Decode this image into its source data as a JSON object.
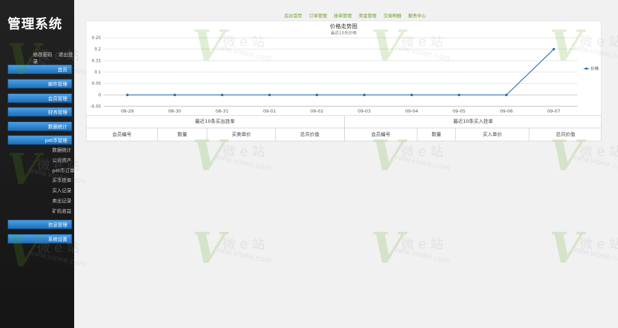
{
  "sidebar": {
    "title": "管理系统",
    "user_links": [
      "修改密码",
      "退出登录"
    ],
    "menu": [
      "首页",
      "邮件管理",
      "会员管理",
      "财务管理",
      "数据统计",
      "pet币管理"
    ],
    "submenu": [
      "数据统计",
      "公司资产",
      "pet币订单",
      "买币挂单",
      "买入记录",
      "卖出记录",
      "矿机收益"
    ],
    "menu_bottom": [
      "信息管理",
      "系统设置"
    ]
  },
  "topnav": [
    "后台首页",
    "订单管理",
    "挂单管理",
    "奖金管理",
    "交易明细",
    "服务中心"
  ],
  "chart_data": {
    "type": "line",
    "title": "价格走势图",
    "subtitle": "最近10天价格",
    "categories": [
      "08-29",
      "08-30",
      "08-31",
      "09-01",
      "09-02",
      "09-03",
      "09-04",
      "09-05",
      "09-06",
      "09-07"
    ],
    "series": [
      {
        "name": "价格",
        "values": [
          0,
          0,
          0,
          0,
          0,
          0,
          0,
          0,
          0,
          0.2
        ]
      }
    ],
    "yticks": [
      "0.25",
      "0.2",
      "0.15",
      "0.1",
      "0.05",
      "0",
      "-0.05"
    ],
    "ylim": [
      -0.05,
      0.25
    ],
    "legend": "right",
    "series_color": "#2b6cb0"
  },
  "tables": {
    "left_caption": "最近10条买出挂单",
    "left_cols": [
      "会员编号",
      "数量",
      "买卖单价",
      "总共价值"
    ],
    "right_caption": "最近10条买入挂单",
    "right_cols": [
      "会员编号",
      "数量",
      "买入单价",
      "总共价值"
    ]
  },
  "watermark": {
    "text": "微 e 站",
    "url": "www.vioee.com",
    "color": "#5aa817"
  }
}
